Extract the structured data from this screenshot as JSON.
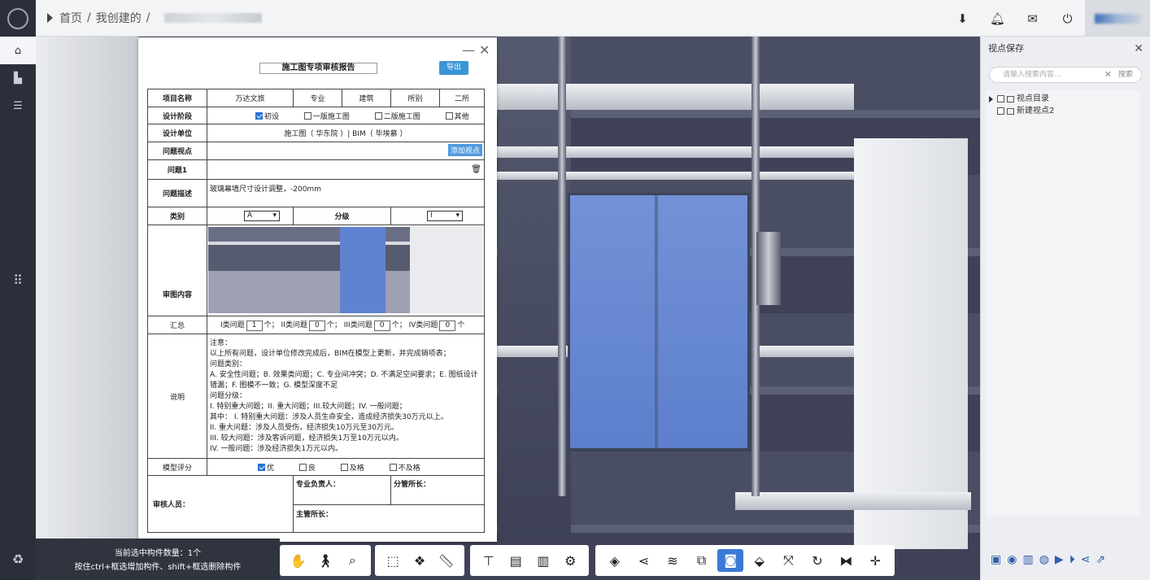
{
  "topbar": {
    "breadcrumb": [
      "首页",
      "/",
      "我创建的",
      "/"
    ],
    "icons": [
      "download-icon",
      "bell-icon",
      "chat-icon",
      "power-icon"
    ]
  },
  "rail": {
    "items": [
      "home-icon",
      "chart-icon",
      "list-icon",
      "apps-grid-icon"
    ]
  },
  "report": {
    "title": "施工图专项审核报告",
    "export_label": "导出",
    "minimize": "—",
    "close": "✕",
    "rows": {
      "project_label": "项目名称",
      "project_value": "万达文旅",
      "discipline_label": "专业",
      "discipline_value": "建筑",
      "office_label": "所别",
      "office_value": "二所",
      "stage_label": "设计阶段",
      "stage_options": [
        {
          "label": "初设",
          "checked": true
        },
        {
          "label": "一版施工图",
          "checked": false
        },
        {
          "label": "二版施工图",
          "checked": false
        },
        {
          "label": "其他",
          "checked": false
        }
      ],
      "unit_label": "设计单位",
      "unit_value": "施工图（   华东院   ）| BIM（   毕埃慕   ）",
      "viewpoint_label": "问题视点",
      "add_viewpoint": "添加视点",
      "issue_label": "问题1",
      "desc_label": "问题描述",
      "desc_value": "玻璃幕墙尺寸设计调整，-200mm",
      "category_label": "类别",
      "category_value": "A",
      "grade_label": "分级",
      "grade_value": "I",
      "review_label": "审图内容",
      "summary_label": "汇总",
      "summary_items": [
        {
          "pre": "I类问题",
          "value": "1",
          "post": "个；"
        },
        {
          "pre": "II类问题",
          "value": "0",
          "post": "个；"
        },
        {
          "pre": "III类问题",
          "value": "0",
          "post": "个；"
        },
        {
          "pre": "IV类问题",
          "value": "0",
          "post": "个"
        }
      ],
      "notes_label": "说明",
      "notes": [
        "注意：",
        "以上所有问题，设计单位修改完成后，BIM在模型上更新，并完成销项表；",
        "问题类别：",
        "A. 安全性问题；B. 效果类问题；C. 专业间冲突；D. 不满足空间要求；E. 图纸设计",
        "错漏；F. 图模不一致；G. 模型深度不足",
        "问题分级：",
        "I. 特别重大问题；II. 重大问题；III.较大问题；IV. 一般问题；",
        "其中：  I. 特别重大问题：涉及人员生命安全，造成经济损失30万元以上。",
        "          II. 重大问题：涉及人员受伤，经济损失10万元至30万元。",
        "          III. 较大问题：涉及客诉问题，经济损失1万至10万元以内。",
        "          IV. 一般问题：涉及经济损失1万元以内。"
      ],
      "score_label": "模型评分",
      "score_options": [
        {
          "label": "优",
          "checked": true
        },
        {
          "label": "良",
          "checked": false
        },
        {
          "label": "及格",
          "checked": false
        },
        {
          "label": "不及格",
          "checked": false
        }
      ],
      "reviewer_label": "审核人员：",
      "lead_label": "专业负责人：",
      "branch_label": "分管所长：",
      "director_label": "主管所长："
    }
  },
  "viewpoint_panel": {
    "title": "视点保存",
    "close": "✕",
    "search_placeholder": "请输入搜索内容...",
    "search_clear": "✕",
    "search_button": "搜索",
    "tree": [
      {
        "label": "视点目录",
        "type": "folder"
      },
      {
        "label": "新建视点2",
        "type": "file"
      }
    ],
    "tools": [
      "folder-add-icon",
      "palette-icon",
      "trash-icon",
      "camera-icon",
      "record-icon",
      "play-icon",
      "share-icon",
      "export-icon"
    ]
  },
  "status": {
    "line1": "当前选中构件数量：1个",
    "line2": "按住ctrl+框选增加构件、shift+框选删除构件"
  }
}
